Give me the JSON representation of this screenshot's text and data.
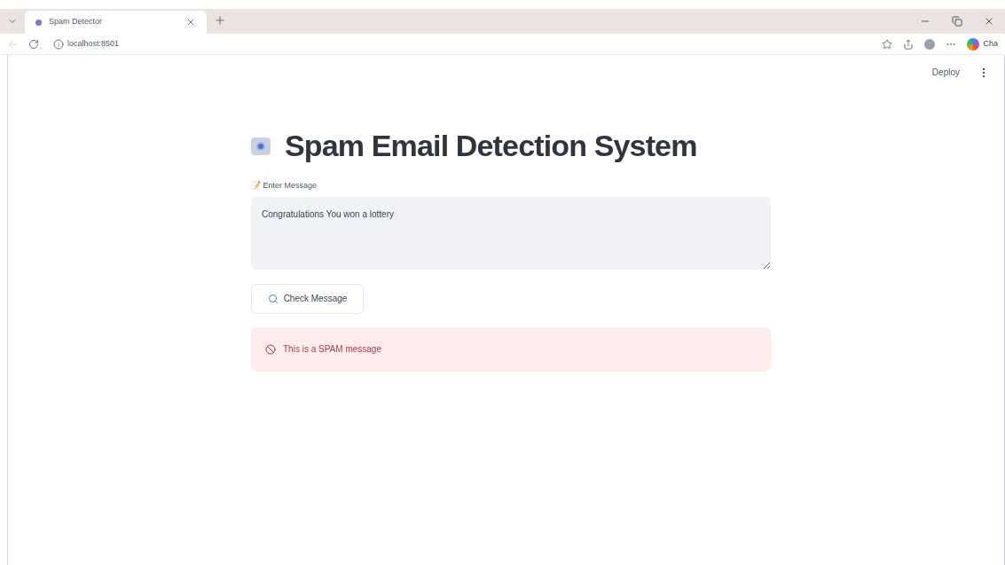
{
  "browser": {
    "tabs": [
      {
        "title": "Spam Detector",
        "selected": true
      }
    ],
    "address": "localhost:8501",
    "copilot_label": "Cha"
  },
  "app": {
    "deploy_label": "Deploy",
    "title": "Spam Email Detection System",
    "input": {
      "label": "📝 Enter Message",
      "value": "Congratulations You won a lottery"
    },
    "button": "Check Message",
    "result": {
      "kind": "error",
      "text": "This is a SPAM message"
    }
  }
}
